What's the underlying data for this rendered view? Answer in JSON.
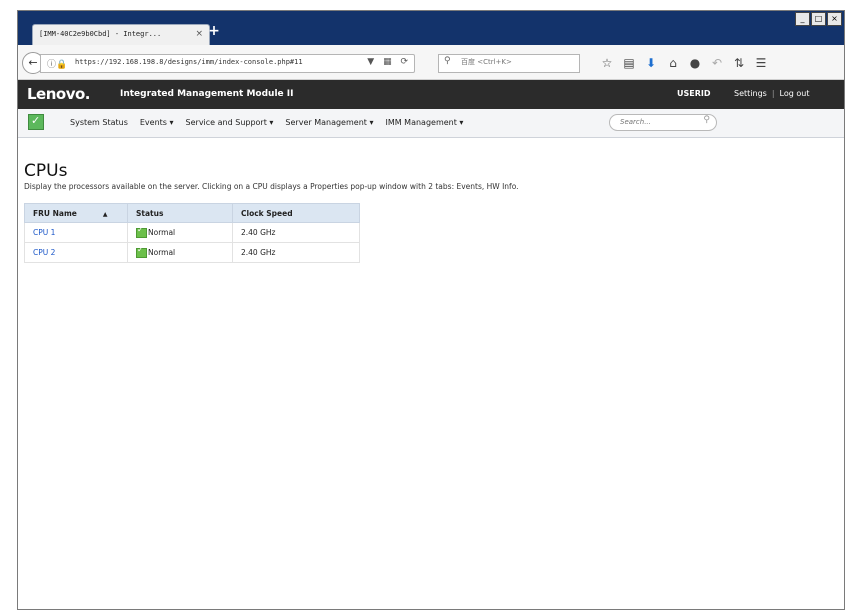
{
  "browser": {
    "tab_title": "[IMM-40C2e9b0Cbd] - Integr...",
    "tab_close": "×",
    "new_tab": "+",
    "window_controls": [
      "_",
      "□",
      "×"
    ],
    "url": "https://192.168.198.8/designs/imm/index-console.php#11",
    "search_placeholder": "百度 <Ctrl+K>",
    "toolbar_icons": [
      "bookmark-star-icon",
      "reading-list-icon",
      "download-icon",
      "home-icon",
      "chat-icon",
      "undo-icon",
      "menu-icon"
    ]
  },
  "header": {
    "brand": "Lenovo.",
    "product": "Integrated Management Module II",
    "user": "USERID",
    "settings": "Settings",
    "logout": "Log out"
  },
  "menu": {
    "items": [
      "System Status",
      "Events ▾",
      "Service and Support ▾",
      "Server Management ▾",
      "IMM Management ▾"
    ],
    "search_placeholder": "Search..."
  },
  "page": {
    "title": "CPUs",
    "description": "Display the processors available on the server. Clicking on a CPU displays a Properties pop-up window with 2 tabs: Events, HW Info."
  },
  "table": {
    "columns": [
      "FRU Name",
      "Status",
      "Clock Speed"
    ],
    "sort_indicator": "▲",
    "rows": [
      {
        "name": "CPU 1",
        "status": "Normal",
        "clock": "2.40 GHz"
      },
      {
        "name": "CPU 2",
        "status": "Normal",
        "clock": "2.40 GHz"
      }
    ]
  },
  "colors": {
    "titlebar": "#13336b",
    "app_header": "#2b2b2b",
    "link": "#1a56c8",
    "status_ok": "#6cbf4a"
  }
}
